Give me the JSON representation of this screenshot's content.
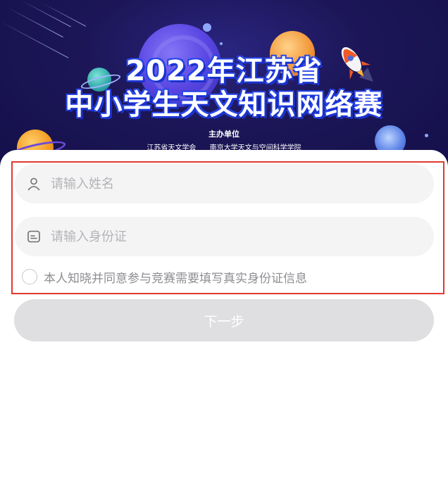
{
  "banner": {
    "title_line1": "2022年江苏省",
    "title_line2": "中小学生天文知识网络赛",
    "sponsor_label": "主办单位",
    "sponsors": [
      "江苏省天文学会",
      "南京大学天文与空间科学学院"
    ]
  },
  "form": {
    "name_placeholder": "请输入姓名",
    "name_value": "",
    "id_placeholder": "请输入身份证",
    "id_value": "",
    "agree_text": "本人知晓并同意参与竞赛需要填写真实身份证信息",
    "agree_checked": false,
    "next_label": "下一步"
  },
  "icons": {
    "name_field": "user-icon",
    "id_field": "id-card-icon"
  },
  "colors": {
    "banner_bg": "#1c1657",
    "highlight_border": "#e03a2f",
    "field_bg": "#f4f4f5",
    "button_bg": "#dfdfe2"
  }
}
